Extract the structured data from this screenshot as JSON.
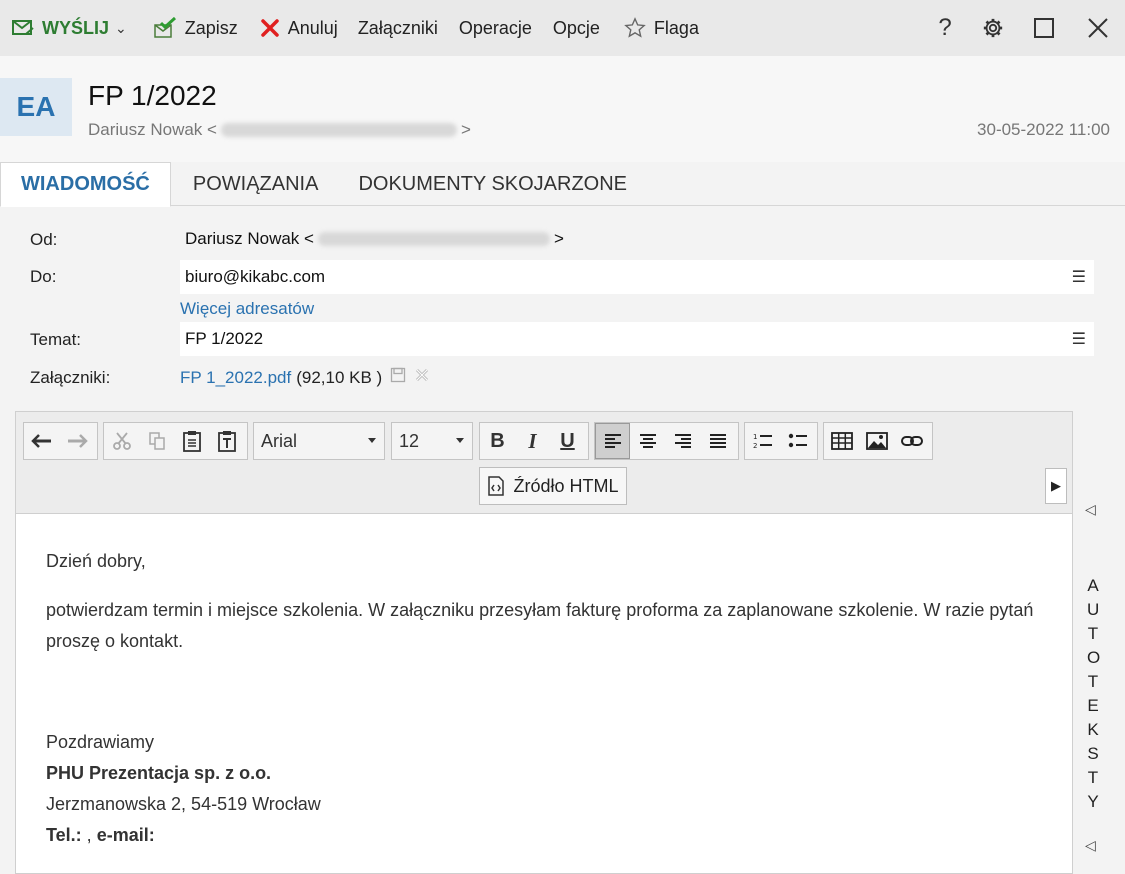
{
  "toolbar": {
    "send_label": "WYŚLIJ",
    "save_label": "Zapisz",
    "cancel_label": "Anuluj",
    "attachments_label": "Załączniki",
    "operations_label": "Operacje",
    "options_label": "Opcje",
    "flag_label": "Flaga",
    "help_label": "?"
  },
  "header": {
    "avatar_initials": "EA",
    "subject": "FP 1/2022",
    "sender_name": "Dariusz Nowak <",
    "sender_close": ">",
    "date": "30-05-2022 11:00"
  },
  "tabs": [
    {
      "label": "WIADOMOŚĆ",
      "active": true
    },
    {
      "label": "POWIĄZANIA",
      "active": false
    },
    {
      "label": "DOKUMENTY SKOJARZONE",
      "active": false
    }
  ],
  "form": {
    "from_label": "Od:",
    "from_value": "Dariusz Nowak <",
    "from_close": ">",
    "to_label": "Do:",
    "to_value": "biuro@kikabc.com",
    "more_recipients": "Więcej adresatów",
    "subject_label": "Temat:",
    "subject_value": "FP 1/2022",
    "attachments_label": "Załączniki:",
    "attachment_name": "FP 1_2022.pdf",
    "attachment_size": "(92,10 KB )"
  },
  "editor": {
    "font_name": "Arial",
    "font_size": "12",
    "bold_label": "B",
    "italic_label": "I",
    "underline_label": "U",
    "source_label": "Źródło HTML",
    "body": {
      "greeting": "Dzień dobry,",
      "paragraph": "potwierdzam termin i miejsce szkolenia. W załączniku przesyłam fakturę proforma za zaplanowane szkolenie. W razie pytań proszę o kontakt.",
      "closing": "Pozdrawiamy",
      "company": "PHU Prezentacja sp. z o.o.",
      "address": "Jerzmanowska 2, 54-519 Wrocław",
      "contact_tel": "Tel.:",
      "contact_sep": " , ",
      "contact_email": "e-mail:"
    }
  },
  "side_panel": {
    "label": "AUTOTEKSTY"
  },
  "colors": {
    "accent": "#2a72b0",
    "send_green": "#2e7d32",
    "cancel_red": "#e02020"
  }
}
